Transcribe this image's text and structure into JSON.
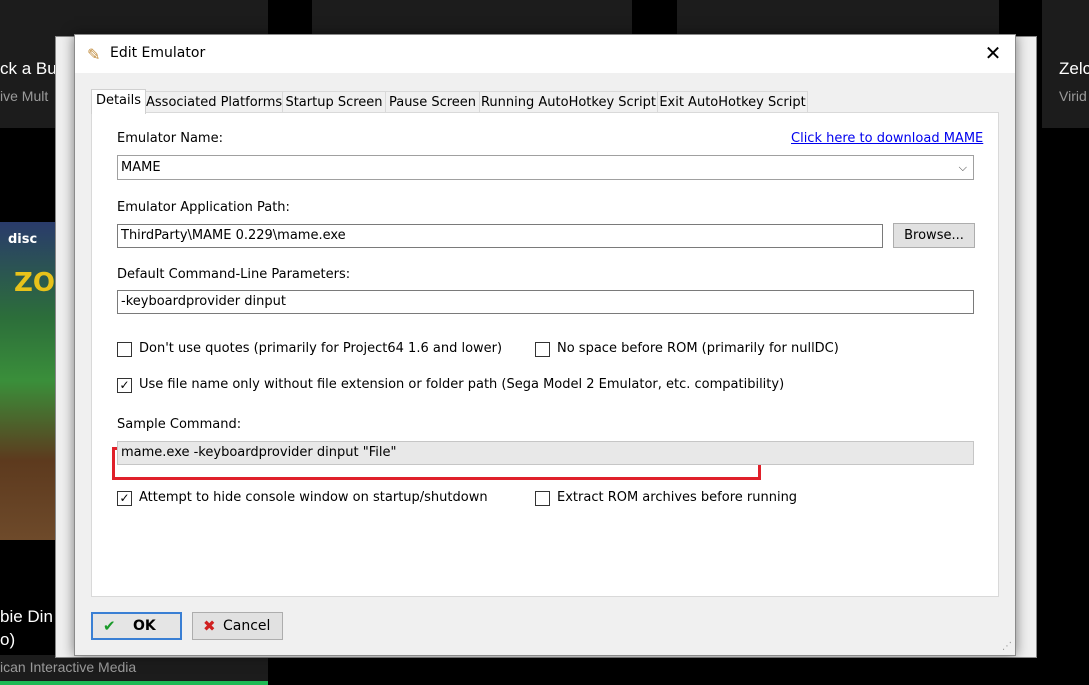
{
  "background": {
    "tile_left_title": "ck a Bu",
    "tile_left_sub": "ive Mult",
    "tile_right_title": "Zelc",
    "tile_right_sub": "Virid",
    "cover_disc_text": "disc",
    "cover_game_text": "ZO",
    "bottom_title_1": "bie Din",
    "bottom_title_2": "o)",
    "bottom_publisher": "ican Interactive Media"
  },
  "dialog": {
    "title": "Edit Emulator",
    "close_glyph": "✕",
    "icon_glyph": "✎"
  },
  "tabs": [
    {
      "label": "Details",
      "active": true
    },
    {
      "label": "Associated Platforms",
      "active": false
    },
    {
      "label": "Startup Screen",
      "active": false
    },
    {
      "label": "Pause Screen",
      "active": false
    },
    {
      "label": "Running AutoHotkey Script",
      "active": false
    },
    {
      "label": "Exit AutoHotkey Script",
      "active": false
    }
  ],
  "details": {
    "emulator_name_label": "Emulator Name:",
    "download_link": "Click here to download MAME",
    "emulator_name_value": "MAME",
    "app_path_label": "Emulator Application Path:",
    "app_path_value": "ThirdParty\\MAME 0.229\\mame.exe",
    "browse_label": "Browse...",
    "params_label": "Default Command-Line Parameters:",
    "params_value": "-keyboardprovider dinput",
    "cb_no_quotes": {
      "label": "Don't use quotes (primarily for Project64 1.6 and lower)",
      "checked": false
    },
    "cb_no_space": {
      "label": "No space before ROM (primarily for nullDC)",
      "checked": false
    },
    "cb_filename_only": {
      "label": "Use file name only without file extension or folder path (Sega Model 2 Emulator, etc. compatibility)",
      "checked": true
    },
    "sample_label": "Sample Command:",
    "sample_value": "mame.exe -keyboardprovider dinput \"File\"",
    "cb_hide_console": {
      "label": "Attempt to hide console window on startup/shutdown",
      "checked": true
    },
    "cb_extract_rom": {
      "label": "Extract ROM archives before running",
      "checked": false
    }
  },
  "footer": {
    "ok_label": "OK",
    "cancel_label": "Cancel",
    "ok_icon": "✔",
    "cancel_icon": "✖"
  },
  "colors": {
    "highlight": "#e0202a",
    "link": "#0000ee",
    "accent_green": "#1db954"
  }
}
